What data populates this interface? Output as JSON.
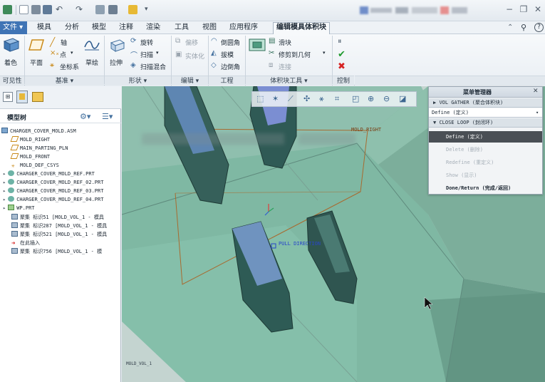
{
  "ribbon_tabs": {
    "file": "文件",
    "mold": "模具",
    "analysis": "分析",
    "model": "模型",
    "annotate": "注释",
    "render": "渲染",
    "tools": "工具",
    "view": "视图",
    "apps": "应用程序",
    "edit_volume": "编辑模具体积块"
  },
  "ribbon": {
    "shade": "着色",
    "plane": "平面",
    "axis": "轴",
    "point": "点",
    "csys": "坐标系",
    "sketch": "草绘",
    "extrude": "拉伸",
    "revolve": "旋转",
    "sweep": "扫描",
    "swept_blend": "扫描混合",
    "offset": "偏移",
    "solidify": "实体化",
    "round": "倒圆角",
    "draft": "拔模",
    "chamfer": "边倒角",
    "slider": "滑块",
    "trim_to_geom": "修剪到几何",
    "join": "连接"
  },
  "ribbon_groups": {
    "visibility": "可见性",
    "datum": "基准",
    "shapes": "形状",
    "editing": "编辑",
    "engineering": "工程",
    "volume_tools": "体积块工具",
    "control": "控制"
  },
  "model_tree": {
    "title": "模型树",
    "items": [
      "CHARGER_COVER_MOLD.ASM",
      "MOLD_RIGHT",
      "MAIN_PARTING_PLN",
      "MOLD_FRONT",
      "MOLD_DEF_CSYS",
      "CHARGER_COVER_MOLD_REF.PRT",
      "CHARGER_COVER_MOLD_REF_02.PRT",
      "CHARGER_COVER_MOLD_REF_03.PRT",
      "CHARGER_COVER_MOLD_REF_04.PRT",
      "WP.PRT",
      "聚集 标识51 [MOLD_VOL_1 - 模具",
      "聚集 标识287 [MOLD_VOL_1 - 模具",
      "聚集 标识521 [MOLD_VOL_1 - 模具",
      "在此插入",
      "聚集 标识756 [MOLD_VOL_1 - 模"
    ]
  },
  "viewport": {
    "label_mold_right": "MOLD_RIGHT",
    "label_pull_direction": "PULL DIRECTION",
    "label_mold_vol": "MOLD_VOL_1"
  },
  "menu_manager": {
    "title": "菜单管理器",
    "vol_gather": "VOL GATHER (聚合体积块)",
    "define_select": "Define (定义)",
    "close_loop": "CLOSE LOOP (封闭环)",
    "items": [
      "Define (定义)",
      "Delete (删除)",
      "Redefine (重定义)",
      "Show (显示)",
      "Done/Return (完成/返回)"
    ]
  }
}
